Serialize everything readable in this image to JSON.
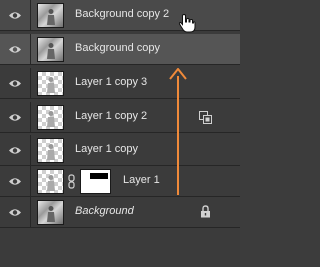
{
  "layers": [
    {
      "name": "Background copy 2",
      "thumb": "photo",
      "state": "hover"
    },
    {
      "name": "Background copy",
      "thumb": "photo",
      "state": "selected"
    },
    {
      "name": "Layer 1 copy 3",
      "thumb": "checker"
    },
    {
      "name": "Layer 1 copy 2",
      "thumb": "checker",
      "badge": "smart-object-icon"
    },
    {
      "name": "Layer 1 copy",
      "thumb": "checker"
    },
    {
      "name": "Layer 1",
      "thumb": "checker",
      "mask": true
    },
    {
      "name": "Background",
      "thumb": "photo",
      "italic": true,
      "badge": "lock-icon"
    }
  ],
  "annotation": {
    "arrow_color": "#f08a3a",
    "direction": "up"
  },
  "colors": {
    "panel": "#3b3b3b",
    "selected": "#555555",
    "text": "#e6e6e6"
  }
}
